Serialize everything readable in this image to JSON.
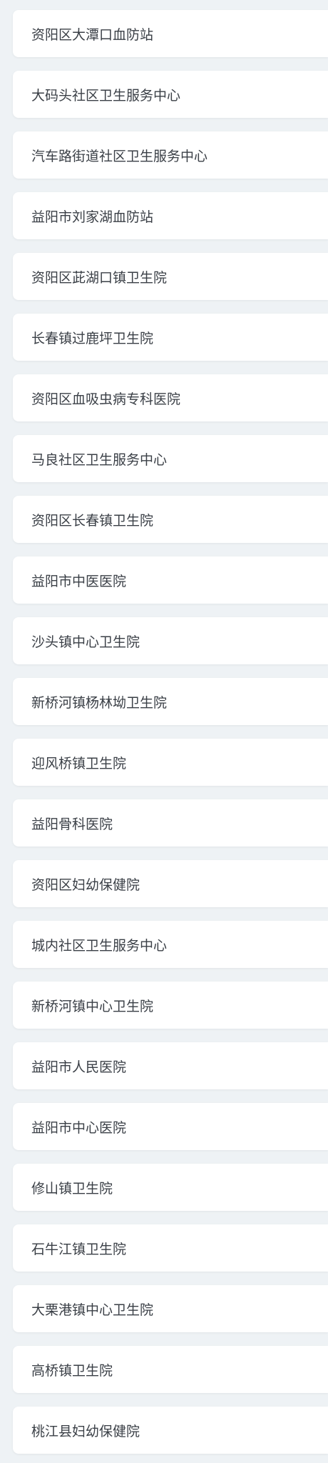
{
  "hospital_list": {
    "items": [
      {
        "label": "资阳区大潭口血防站"
      },
      {
        "label": "大码头社区卫生服务中心"
      },
      {
        "label": "汽车路街道社区卫生服务中心"
      },
      {
        "label": "益阳市刘家湖血防站"
      },
      {
        "label": "资阳区茈湖口镇卫生院"
      },
      {
        "label": "长春镇过鹿坪卫生院"
      },
      {
        "label": "资阳区血吸虫病专科医院"
      },
      {
        "label": "马良社区卫生服务中心"
      },
      {
        "label": "资阳区长春镇卫生院"
      },
      {
        "label": "益阳市中医医院"
      },
      {
        "label": "沙头镇中心卫生院"
      },
      {
        "label": "新桥河镇杨林坳卫生院"
      },
      {
        "label": "迎风桥镇卫生院"
      },
      {
        "label": "益阳骨科医院"
      },
      {
        "label": "资阳区妇幼保健院"
      },
      {
        "label": "城内社区卫生服务中心"
      },
      {
        "label": "新桥河镇中心卫生院"
      },
      {
        "label": "益阳市人民医院"
      },
      {
        "label": "益阳市中心医院"
      },
      {
        "label": "修山镇卫生院"
      },
      {
        "label": "石牛江镇卫生院"
      },
      {
        "label": "大栗港镇中心卫生院"
      },
      {
        "label": "高桥镇卫生院"
      },
      {
        "label": "桃江县妇幼保健院"
      }
    ]
  }
}
